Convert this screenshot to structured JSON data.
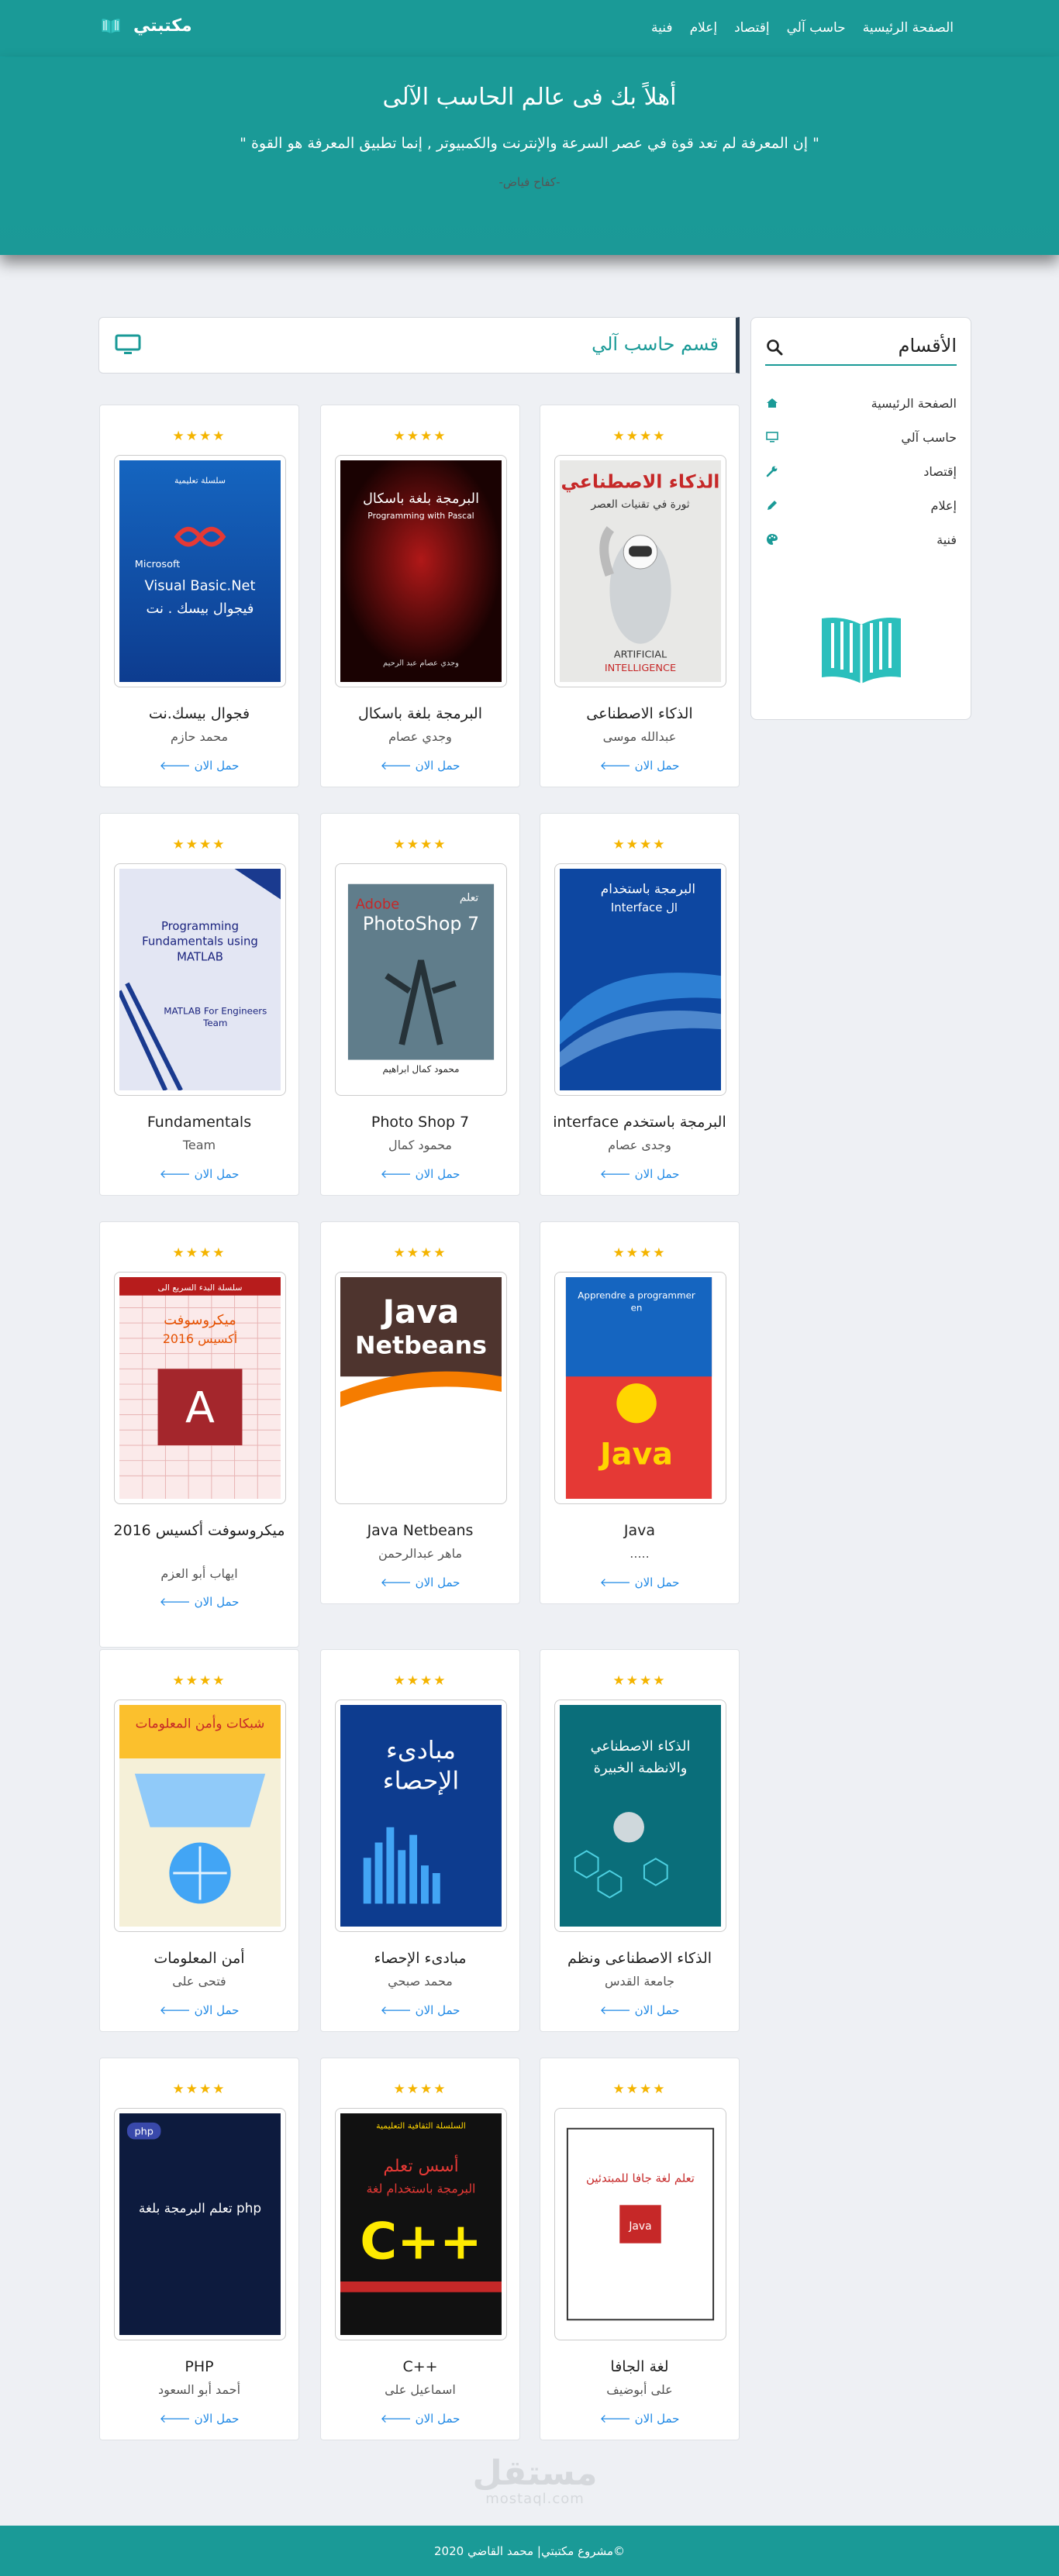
{
  "nav": {
    "links": [
      "الصفحة الرئيسية",
      "حاسب آلي",
      "إقتصاد",
      "إعلام",
      "فنية"
    ],
    "brand": "مكتبتي"
  },
  "hero": {
    "title": "أهلاً بك فى عالم الحاسب الآلى",
    "quote": "\" إن المعرفة لم تعد قوة في عصر السرعة والإنترنت والكمبيوتر , إنما تطبيق المعرفة هو القوة \"",
    "author": "-كفاح فياض-"
  },
  "sidebar": {
    "title": "الأقسام",
    "items": [
      {
        "label": "الصفحة الرئيسية",
        "icon": "home-icon"
      },
      {
        "label": "حاسب آلي",
        "icon": "desktop-icon"
      },
      {
        "label": "إقتصاد",
        "icon": "wrench-icon"
      },
      {
        "label": "إعلام",
        "icon": "pencil-icon"
      },
      {
        "label": "فنية",
        "icon": "palette-icon"
      }
    ]
  },
  "section": {
    "title": "قسم حاسب آلي"
  },
  "colors": {
    "primary": "#1a9a97",
    "star": "#f4b400",
    "link": "#1e88e5"
  },
  "books": [
    {
      "title": "الذكاء الاصطناعى",
      "author": "عبدالله موسى",
      "download": "حمل الان"
    },
    {
      "title": "البرمجة بلغة باسكال",
      "author": "وجدي عصام",
      "download": "حمل الان"
    },
    {
      "title": "فجوال بيسك.نت",
      "author": "محمد حازم",
      "download": "حمل الان"
    },
    {
      "title": "interface البرمجة باستخدم",
      "author": "وجدى عصام",
      "download": "حمل الان"
    },
    {
      "title": "Photo Shop 7",
      "author": "محمود كمال",
      "download": "حمل الان"
    },
    {
      "title": "Fundamentals",
      "author": "Team",
      "download": "حمل الان"
    },
    {
      "title": "Java",
      "author": ".....",
      "download": "حمل الان"
    },
    {
      "title": "Java Netbeans",
      "author": "ماهر عبدالرحمن",
      "download": "حمل الان"
    },
    {
      "title": "ميكروسوفت أكسيس 2016",
      "author": "ايهاب أبو العزم",
      "download": "حمل الان"
    },
    {
      "title": "الذكاء الاصطناعى ونظم",
      "author": "جامعة القدس",
      "download": "حمل الان"
    },
    {
      "title": "مبادىء الإحصاء",
      "author": "محمد صبحي",
      "download": "حمل الان"
    },
    {
      "title": "أمن المعلومات",
      "author": "فتحى على",
      "download": "حمل الان"
    },
    {
      "title": "لغة الجافا",
      "author": "على أبوضيف",
      "download": "حمل الان"
    },
    {
      "title": "C++",
      "author": "اسماعيل على",
      "download": "حمل الان"
    },
    {
      "title": "PHP",
      "author": "أحمد أبو السعود",
      "download": "حمل الان"
    }
  ],
  "covers": {
    "ai": {
      "line1": "الذكاء الاصطناعي",
      "line2": "ثورة في تقنيات العصر",
      "en1": "ARTIFICIAL",
      "en2": "INTELLIGENCE"
    },
    "pascal": {
      "line1": "البرمجة بلغة باسكال",
      "en": "Programming with Pascal",
      "author": "وجدي عصام عبد الرحيم"
    },
    "vbnet": {
      "top": "سلسلة تعليمية",
      "en": "Microsoft",
      "title": "Visual Basic.Net",
      "ar": "فيجوال بيسك . نت"
    },
    "interface": {
      "line1": "البرمجة باستخدام",
      "line2": "Interface ال"
    },
    "photoshop": {
      "ar": "تعلم",
      "en1": "Adobe",
      "en2": "PhotoShop 7",
      "author": "محمود كمال ابراهيم"
    },
    "matlab": {
      "line1": "Programming",
      "line2": "Fundamentals using",
      "line3": "MATLAB",
      "line4": "MATLAB For Engineers",
      "line5": "Team"
    },
    "java": {
      "top": "Apprendre a programmer",
      "top2": "en",
      "word": "Java"
    },
    "netbeans": {
      "line1": "Java",
      "line2": "Netbeans"
    },
    "access": {
      "top": "سلسلة البدء السريع الى",
      "title": "ميكروسوفت",
      "sub": "أكسيس 2016",
      "letter": "A"
    },
    "aiexpert": {
      "line1": "الذكاء الاصطناعي",
      "line2": "والانظمة الخبيرة"
    },
    "stats": {
      "line1": "مبادىء",
      "line2": "الإحصاء"
    },
    "security": {
      "line1": "شبكات وأمن المعلومات"
    },
    "javaar": {
      "title": "تعلم لغة جافا للمبتدئين",
      "word": "Java"
    },
    "cpp": {
      "top": "السلسلة الثقافية التعليمية",
      "line1": "أسس تعلم",
      "line2": "البرمجة باستخدام لغة",
      "word": "C++"
    },
    "php": {
      "tag": "php",
      "line1": "تعلم البرمجة بلغة php"
    }
  },
  "watermark": {
    "big": "مستقل",
    "small": "mostaql.com"
  },
  "footer": {
    "text": "مشروع مكتبتي| محمد القاضي 2020©"
  }
}
